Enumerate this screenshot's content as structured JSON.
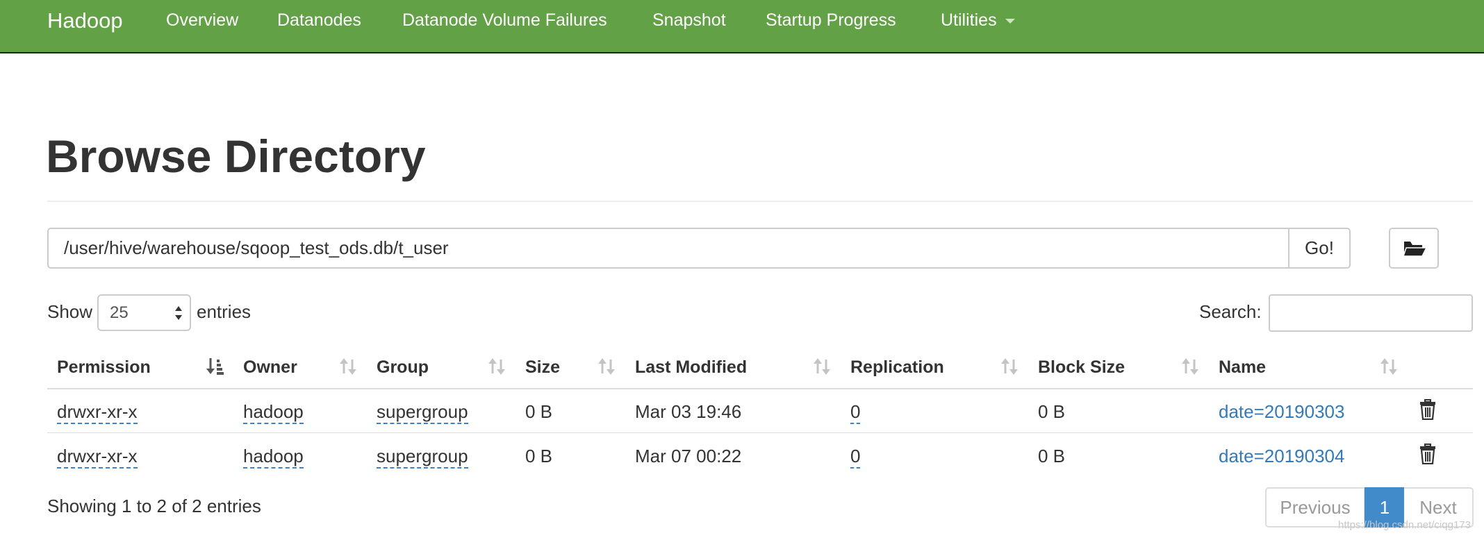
{
  "navbar": {
    "brand": "Hadoop",
    "items": [
      "Overview",
      "Datanodes",
      "Datanode Volume Failures",
      "Snapshot",
      "Startup Progress",
      "Utilities"
    ]
  },
  "page": {
    "title": "Browse Directory"
  },
  "path_bar": {
    "value": "/user/hive/warehouse/sqoop_test_ods.db/t_user",
    "go_label": "Go!"
  },
  "length": {
    "show_label": "Show",
    "selected": "25",
    "entries_label": "entries"
  },
  "search": {
    "label": "Search:",
    "value": ""
  },
  "table": {
    "columns": [
      "Permission",
      "Owner",
      "Group",
      "Size",
      "Last Modified",
      "Replication",
      "Block Size",
      "Name"
    ],
    "rows": [
      {
        "permission": "drwxr-xr-x",
        "owner": "hadoop",
        "group": "supergroup",
        "size": "0 B",
        "last_modified": "Mar 03 19:46",
        "replication": "0",
        "block_size": "0 B",
        "name": "date=20190303"
      },
      {
        "permission": "drwxr-xr-x",
        "owner": "hadoop",
        "group": "supergroup",
        "size": "0 B",
        "last_modified": "Mar 07 00:22",
        "replication": "0",
        "block_size": "0 B",
        "name": "date=20190304"
      }
    ]
  },
  "footer": {
    "info": "Showing 1 to 2 of 2 entries",
    "pagination": {
      "previous": "Previous",
      "current": "1",
      "next": "Next"
    }
  },
  "watermark": "https://blog.csdn.net/ciqg173",
  "colors": {
    "navbar": "#62a145",
    "link": "#337ab7",
    "pager_active": "#428bca"
  },
  "icons": {
    "folder": "folder-open-icon",
    "trash": "trash-icon",
    "sort": "sort-icon",
    "caret": "caret-down-icon"
  }
}
